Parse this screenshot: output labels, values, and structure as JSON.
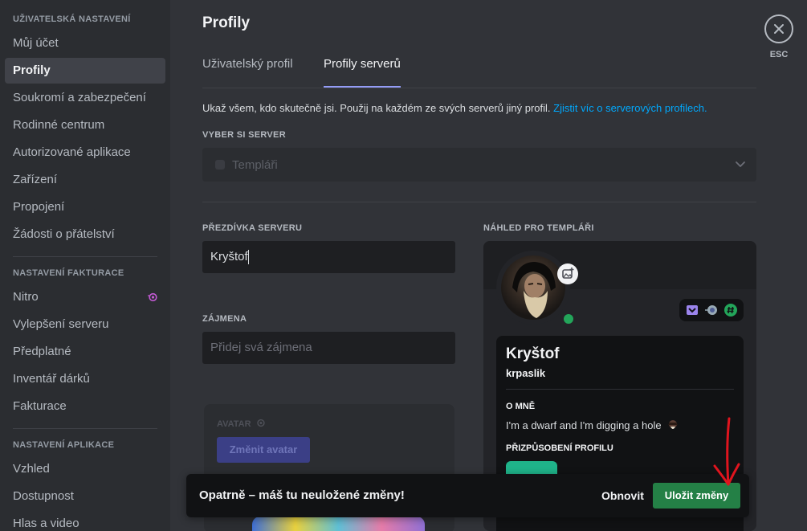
{
  "sidebar": {
    "user_settings_header": "UŽIVATELSKÁ NASTAVENÍ",
    "user_items": [
      {
        "label": "Můj účet"
      },
      {
        "label": "Profily"
      },
      {
        "label": "Soukromí a zabezpečení"
      },
      {
        "label": "Rodinné centrum"
      },
      {
        "label": "Autorizované aplikace"
      },
      {
        "label": "Zařízení"
      },
      {
        "label": "Propojení"
      },
      {
        "label": "Žádosti o přátelství"
      }
    ],
    "billing_header": "NASTAVENÍ FAKTURACE",
    "billing_items": [
      {
        "label": "Nitro"
      },
      {
        "label": "Vylepšení serveru"
      },
      {
        "label": "Předplatné"
      },
      {
        "label": "Inventář dárků"
      },
      {
        "label": "Fakturace"
      }
    ],
    "app_header": "NASTAVENÍ APLIKACE",
    "app_items": [
      {
        "label": "Vzhled"
      },
      {
        "label": "Dostupnost"
      },
      {
        "label": "Hlas a video"
      }
    ]
  },
  "main": {
    "title": "Profily",
    "tabs": [
      {
        "label": "Uživatelský profil"
      },
      {
        "label": "Profily serverů"
      }
    ],
    "description": "Ukaž všem, kdo skutečně jsi. Použij na každém ze svých serverů jiný profil.",
    "description_link": "Zjistit víc o serverových profilech.",
    "server_select_label": "VYBER SI SERVER",
    "server_select_value": "Templáři",
    "nickname_label": "PŘEZDÍVKA SERVERU",
    "nickname_value": "Kryštof",
    "pronouns_label": "ZÁJMENA",
    "pronouns_placeholder": "Přidej svá zájmena",
    "avatar_label": "AVATAR",
    "change_avatar_button": "Změnit avatar"
  },
  "preview": {
    "label": "NÁHLED PRO TEMPLÁŘI",
    "display_name": "Kryštof",
    "username": "krpaslik",
    "about_header": "O MNĚ",
    "about_text": "I'm a dwarf and I'm digging a hole",
    "customization_header": "PŘIZPŮSOBENÍ PROFILU"
  },
  "close": {
    "esc_label": "ESC"
  },
  "notice": {
    "message": "Opatrně – máš tu neuložené změny!",
    "reset_label": "Obnovit",
    "save_label": "Uložit změny"
  },
  "colors": {
    "accent": "#949cf7",
    "link": "#00a8fc",
    "save_green": "#248046",
    "online": "#23a55a",
    "annotation_red": "#e0141e"
  }
}
